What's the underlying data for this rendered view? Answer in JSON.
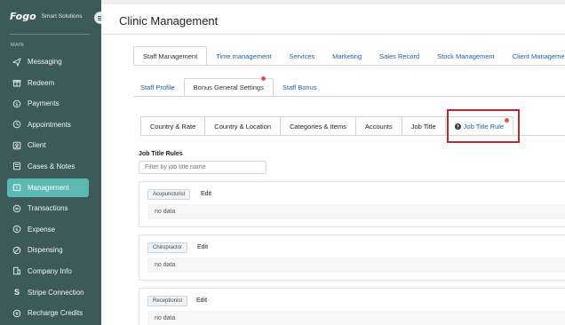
{
  "sidebar": {
    "brand": "Fogo",
    "tagline": "Smart Solutions",
    "section": "MAIN",
    "items": [
      {
        "label": "Messaging",
        "icon": "send-icon"
      },
      {
        "label": "Redeem",
        "icon": "gift-icon"
      },
      {
        "label": "Payments",
        "icon": "payments-icon"
      },
      {
        "label": "Appointments",
        "icon": "clock-icon"
      },
      {
        "label": "Client",
        "icon": "client-icon"
      },
      {
        "label": "Cases & Notes",
        "icon": "notes-icon"
      },
      {
        "label": "Management",
        "icon": "management-icon"
      },
      {
        "label": "Transactions",
        "icon": "transactions-icon"
      },
      {
        "label": "Expense",
        "icon": "expense-icon"
      },
      {
        "label": "Dispensing",
        "icon": "dispensing-icon"
      },
      {
        "label": "Company Info",
        "icon": "building-icon"
      },
      {
        "label": "Stripe Connection",
        "icon": "stripe-icon"
      },
      {
        "label": "Recharge Credits",
        "icon": "recharge-icon"
      }
    ],
    "active_index": 6
  },
  "header": {
    "title": "Clinic Management"
  },
  "main_tabs": [
    "Staff Management",
    "Time management",
    "Services",
    "Marketing",
    "Sales Record",
    "Stock Management",
    "Client Management"
  ],
  "sub_tabs": [
    "Staff Profile",
    "Bonus General Settings",
    "Staff Bonus"
  ],
  "inner_tabs": [
    "Country & Rate",
    "Country & Location",
    "Categories & Items",
    "Accounts",
    "Job Title",
    "Job Title Rule"
  ],
  "job_title_rules": {
    "label": "Job Title Rules",
    "filter_placeholder": "Filter by job title name",
    "rules": [
      {
        "title": "Acupuncturist",
        "edit": "Edit",
        "content": "no data"
      },
      {
        "title": "Chiropractor",
        "edit": "Edit",
        "content": "no data"
      },
      {
        "title": "Receptionist",
        "edit": "Edit",
        "content": "no data"
      }
    ]
  },
  "colors": {
    "sidebar": "#3d5a5b",
    "active": "#5cb8b2",
    "link": "#1e5fa8",
    "alert": "#c2252b"
  }
}
